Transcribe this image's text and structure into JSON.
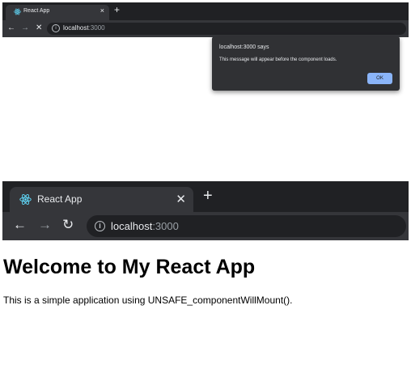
{
  "top_browser": {
    "tab_title": "React App",
    "tab_close": "×",
    "new_tab": "+",
    "back": "←",
    "forward": "→",
    "stop": "✕",
    "info": "i",
    "url_host": "localhost",
    "url_port": ":3000"
  },
  "alert": {
    "title": "localhost:3000 says",
    "message": "This message will appear before the component loads.",
    "ok_label": "OK"
  },
  "bottom_browser": {
    "tab_title": "React App",
    "tab_close": "✕",
    "new_tab": "+",
    "back": "←",
    "forward": "→",
    "reload": "↻",
    "info": "i",
    "url_host": "localhost",
    "url_port": ":3000"
  },
  "page": {
    "heading": "Welcome to My React App",
    "paragraph": "This is a simple application using UNSAFE_componentWillMount()."
  },
  "colors": {
    "frame": "#202124",
    "toolbar": "#35363a",
    "dialog": "#303134",
    "ok_button": "#8ab4f8",
    "react_logo": "#61dafb"
  }
}
